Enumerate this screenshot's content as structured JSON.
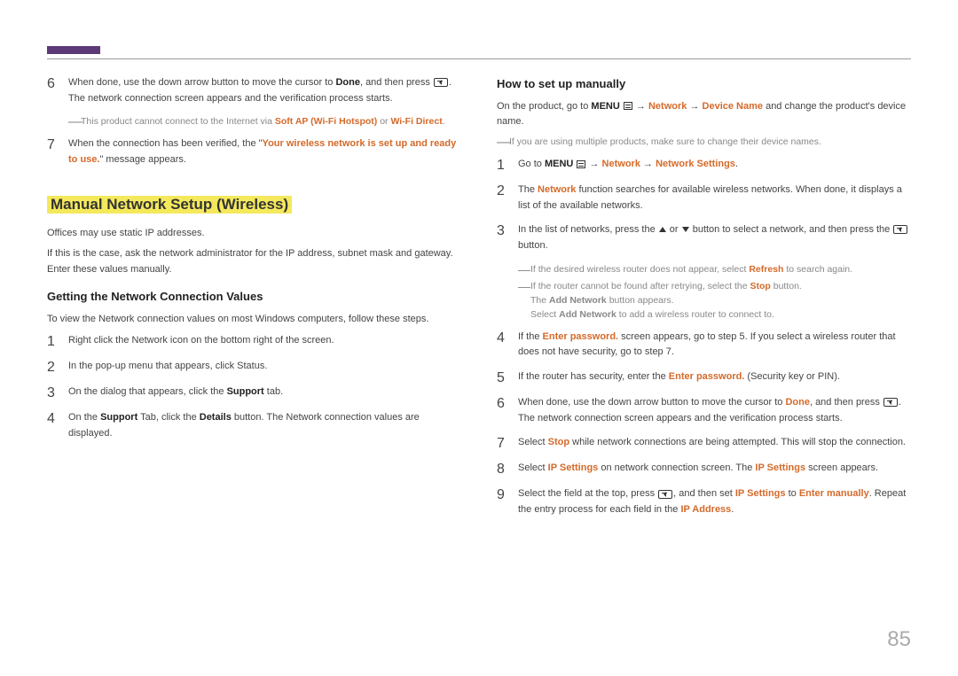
{
  "left": {
    "steps_top": [
      {
        "num": "6",
        "pre": "When done, use the down arrow button to move the cursor to ",
        "bold1": "Done",
        "mid": ", and then press ",
        "icon": "enter",
        "post": ". The network connection screen appears and the verification process starts."
      },
      {
        "note_pre": "This product cannot connect to the Internet via ",
        "note_o1": "Soft AP (Wi-Fi Hotspot)",
        "note_mid": " or ",
        "note_o2": "Wi-Fi Direct",
        "note_post": "."
      },
      {
        "num": "7",
        "pre": "When the connection has been verified, the \"",
        "orange": "Your wireless network is set up and ready to use.",
        "post": "\" message appears."
      }
    ],
    "section_title": "Manual Network Setup (Wireless)",
    "p1": "Offices may use static IP addresses.",
    "p2": "If this is the case, ask the network administrator for the IP address, subnet mask and gateway. Enter these values manually.",
    "sub_title": "Getting the Network Connection Values",
    "p3": "To view the Network connection values on most Windows computers, follow these steps.",
    "steps_b": [
      {
        "num": "1",
        "text": "Right click the Network icon on the bottom right of the screen."
      },
      {
        "num": "2",
        "text": "In the pop-up menu that appears, click Status."
      },
      {
        "num": "3",
        "pre": "On the dialog that appears, click the ",
        "bold": "Support",
        "post": " tab."
      },
      {
        "num": "4",
        "pre": "On the ",
        "bold": "Support",
        "mid": " Tab, click the ",
        "bold2": "Details",
        "post": " button. The Network connection values are displayed."
      }
    ]
  },
  "right": {
    "sub_title": "How to set up manually",
    "intro_pre": "On the product, go to ",
    "intro_b1": "MENU",
    "intro_icon": "menu",
    "intro_mid": " → ",
    "intro_o1": "Network",
    "intro_mid2": " → ",
    "intro_o2": "Device Name",
    "intro_post": " and change the product's device name.",
    "note1": "If you are using multiple products, make sure to change their device names.",
    "steps": [
      {
        "num": "1",
        "pre": "Go to ",
        "b": "MENU",
        "icon": "menu",
        "mid": " → ",
        "o1": "Network",
        "mid2": " → ",
        "o2": "Network Settings",
        "post": "."
      },
      {
        "num": "2",
        "pre": "The ",
        "o": "Network",
        "post": " function searches for available wireless networks. When done, it displays a list of the available networks."
      },
      {
        "num": "3",
        "pre": "In the list of networks, press the ",
        "icon1": "up",
        "mid": " or ",
        "icon2": "down",
        "mid2": " button to select a network, and then press the ",
        "icon3": "enter",
        "post": " button."
      },
      {
        "note_a_pre": "If the desired wireless router does not appear, select ",
        "note_a_o": "Refresh",
        "note_a_post": " to search again."
      },
      {
        "note_b_pre": "If the router cannot be found after retrying, select the ",
        "note_b_o": "Stop",
        "note_b_post": " button."
      },
      {
        "line1_pre": "The ",
        "line1_b": "Add Network",
        "line1_post": " button appears."
      },
      {
        "line2_pre": "Select ",
        "line2_b": "Add Network",
        "line2_post": " to add a wireless router to connect to."
      },
      {
        "num": "4",
        "pre": "If the ",
        "o": "Enter password.",
        "post": " screen appears, go to step 5. If you select a wireless router that does not have security, go to step 7."
      },
      {
        "num": "5",
        "pre": "If the router has security, enter the ",
        "o": "Enter password.",
        "post": " (Security key or PIN)."
      },
      {
        "num": "6",
        "pre": "When done, use the down arrow button to move the cursor to ",
        "o": "Done",
        "mid": ", and then press ",
        "icon": "enter",
        "post": ". The network connection screen appears and the verification process starts."
      },
      {
        "num": "7",
        "pre": "Select ",
        "o": "Stop",
        "post": " while network connections are being attempted. This will stop the connection."
      },
      {
        "num": "8",
        "pre": "Select ",
        "o": "IP Settings",
        "mid": " on network connection screen. The ",
        "o2": "IP Settings",
        "post": " screen appears."
      },
      {
        "num": "9",
        "pre": "Select the field at the top, press ",
        "icon": "enter",
        "mid": ", and then set ",
        "o": "IP Settings",
        "mid2": " to ",
        "o2": "Enter manually",
        "post": ". Repeat the entry process for each field in the ",
        "o3": "IP Address",
        "post2": "."
      }
    ]
  },
  "page_number": "85"
}
